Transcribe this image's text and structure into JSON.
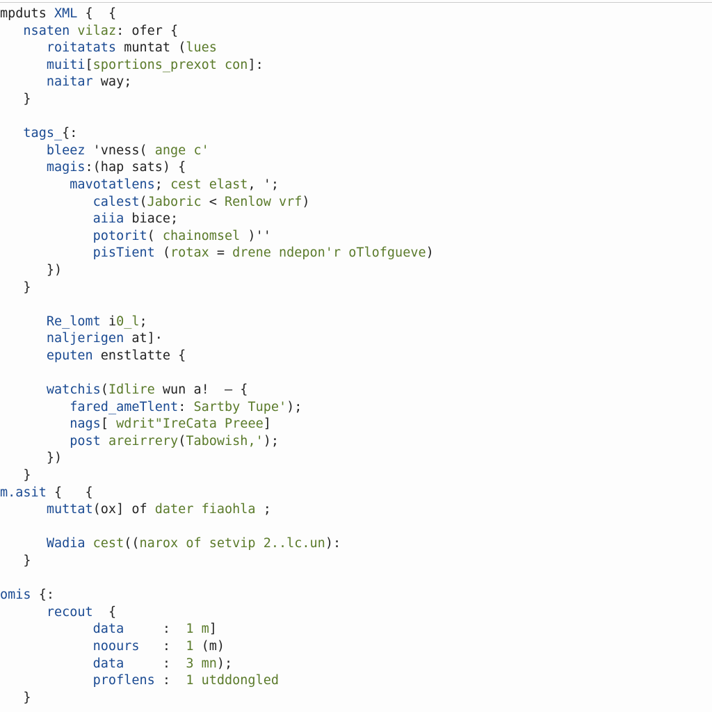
{
  "code": {
    "lines": [
      {
        "indent": 0,
        "spans": [
          {
            "t": "mpduts ",
            "c": "pl"
          },
          {
            "t": "XML ",
            "c": "kw"
          },
          {
            "t": "{  {",
            "c": "pl"
          }
        ]
      },
      {
        "indent": 1,
        "spans": [
          {
            "t": "nsaten ",
            "c": "kw"
          },
          {
            "t": "vilaz",
            "c": "fn"
          },
          {
            "t": ": ofer {",
            "c": "pl"
          }
        ]
      },
      {
        "indent": 2,
        "spans": [
          {
            "t": "roitatats ",
            "c": "kw"
          },
          {
            "t": "muntat ",
            "c": "pl"
          },
          {
            "t": "(",
            "c": "pl"
          },
          {
            "t": "lues",
            "c": "fn"
          }
        ]
      },
      {
        "indent": 2,
        "spans": [
          {
            "t": "muiti",
            "c": "kw"
          },
          {
            "t": "[",
            "c": "pl"
          },
          {
            "t": "sportions_prexot con",
            "c": "fn"
          },
          {
            "t": "]:",
            "c": "pl"
          }
        ]
      },
      {
        "indent": 2,
        "spans": [
          {
            "t": "naitar ",
            "c": "kw"
          },
          {
            "t": "way;",
            "c": "pl"
          }
        ]
      },
      {
        "indent": 1,
        "spans": [
          {
            "t": "}",
            "c": "pl"
          }
        ]
      },
      {
        "indent": 0,
        "spans": [
          {
            "t": "",
            "c": "pl"
          }
        ]
      },
      {
        "indent": 1,
        "spans": [
          {
            "t": "tags_",
            "c": "kw"
          },
          {
            "t": "{:",
            "c": "pl"
          }
        ]
      },
      {
        "indent": 2,
        "spans": [
          {
            "t": "bleez ",
            "c": "kw"
          },
          {
            "t": "'vness( ",
            "c": "pl"
          },
          {
            "t": "ange c'",
            "c": "fn"
          }
        ]
      },
      {
        "indent": 2,
        "spans": [
          {
            "t": "magis",
            "c": "kw"
          },
          {
            "t": ":(hap sats) {",
            "c": "pl"
          }
        ]
      },
      {
        "indent": 3,
        "spans": [
          {
            "t": "mavotatlens",
            "c": "kw"
          },
          {
            "t": "; ",
            "c": "pl"
          },
          {
            "t": "cest elast",
            "c": "fn"
          },
          {
            "t": ", ';",
            "c": "pl"
          }
        ]
      },
      {
        "indent": 4,
        "spans": [
          {
            "t": "calest",
            "c": "kw"
          },
          {
            "t": "(",
            "c": "pl"
          },
          {
            "t": "Jaboric ",
            "c": "fn"
          },
          {
            "t": "< ",
            "c": "pl"
          },
          {
            "t": "Renlow vrf",
            "c": "fn"
          },
          {
            "t": ")",
            "c": "pl"
          }
        ]
      },
      {
        "indent": 4,
        "spans": [
          {
            "t": "aiia ",
            "c": "kw"
          },
          {
            "t": "biace;",
            "c": "pl"
          }
        ]
      },
      {
        "indent": 4,
        "spans": [
          {
            "t": "potorit",
            "c": "kw"
          },
          {
            "t": "( ",
            "c": "pl"
          },
          {
            "t": "chainomsel",
            "c": "fn"
          },
          {
            "t": " )''",
            "c": "pl"
          }
        ]
      },
      {
        "indent": 4,
        "spans": [
          {
            "t": "pisTient ",
            "c": "kw"
          },
          {
            "t": "(",
            "c": "pl"
          },
          {
            "t": "rotax ",
            "c": "fn"
          },
          {
            "t": "= ",
            "c": "pl"
          },
          {
            "t": "drene ndepon'r oTlofgueve",
            "c": "fn"
          },
          {
            "t": ")",
            "c": "pl"
          }
        ]
      },
      {
        "indent": 2,
        "spans": [
          {
            "t": "})",
            "c": "pl"
          }
        ]
      },
      {
        "indent": 1,
        "spans": [
          {
            "t": "}",
            "c": "pl"
          }
        ]
      },
      {
        "indent": 0,
        "spans": [
          {
            "t": "",
            "c": "pl"
          }
        ]
      },
      {
        "indent": 2,
        "spans": [
          {
            "t": "Re_lomt ",
            "c": "kw"
          },
          {
            "t": "i",
            "c": "pl"
          },
          {
            "t": "0_l",
            "c": "fn"
          },
          {
            "t": ";",
            "c": "pl"
          }
        ]
      },
      {
        "indent": 2,
        "spans": [
          {
            "t": "naljerigen ",
            "c": "kw"
          },
          {
            "t": "at]·",
            "c": "pl"
          }
        ]
      },
      {
        "indent": 2,
        "spans": [
          {
            "t": "eputen ",
            "c": "kw"
          },
          {
            "t": "enstlatte {",
            "c": "pl"
          }
        ]
      },
      {
        "indent": 0,
        "spans": [
          {
            "t": "",
            "c": "pl"
          }
        ]
      },
      {
        "indent": 2,
        "spans": [
          {
            "t": "watchis",
            "c": "kw"
          },
          {
            "t": "(",
            "c": "pl"
          },
          {
            "t": "Idlire ",
            "c": "fn"
          },
          {
            "t": "wun a!  — {",
            "c": "pl"
          }
        ]
      },
      {
        "indent": 3,
        "spans": [
          {
            "t": "fared_ameTlent",
            "c": "kw"
          },
          {
            "t": ": ",
            "c": "pl"
          },
          {
            "t": "Sartby Tupe'",
            "c": "fn"
          },
          {
            "t": ");",
            "c": "pl"
          }
        ]
      },
      {
        "indent": 3,
        "spans": [
          {
            "t": "nags",
            "c": "kw"
          },
          {
            "t": "[ ",
            "c": "pl"
          },
          {
            "t": "wdrit\"IreCata Preee",
            "c": "fn"
          },
          {
            "t": "]",
            "c": "pl"
          }
        ]
      },
      {
        "indent": 3,
        "spans": [
          {
            "t": "post ",
            "c": "kw"
          },
          {
            "t": "areirrery",
            "c": "fn"
          },
          {
            "t": "(",
            "c": "pl"
          },
          {
            "t": "Tabowish,'",
            "c": "fn"
          },
          {
            "t": ");",
            "c": "pl"
          }
        ]
      },
      {
        "indent": 2,
        "spans": [
          {
            "t": "})",
            "c": "pl"
          }
        ]
      },
      {
        "indent": 1,
        "spans": [
          {
            "t": "}",
            "c": "pl"
          }
        ]
      },
      {
        "indent": 0,
        "spans": [
          {
            "t": "m.asit ",
            "c": "kw"
          },
          {
            "t": "{   {",
            "c": "pl"
          }
        ]
      },
      {
        "indent": 2,
        "spans": [
          {
            "t": "muttat",
            "c": "kw"
          },
          {
            "t": "(ox] of ",
            "c": "pl"
          },
          {
            "t": "dater fiaohla",
            "c": "fn"
          },
          {
            "t": " ;",
            "c": "pl"
          }
        ]
      },
      {
        "indent": 0,
        "spans": [
          {
            "t": "",
            "c": "pl"
          }
        ]
      },
      {
        "indent": 2,
        "spans": [
          {
            "t": "Wadia ",
            "c": "kw"
          },
          {
            "t": "cest",
            "c": "fn"
          },
          {
            "t": "((",
            "c": "pl"
          },
          {
            "t": "narox of setvip 2..lc.un",
            "c": "fn"
          },
          {
            "t": "):",
            "c": "pl"
          }
        ]
      },
      {
        "indent": 1,
        "spans": [
          {
            "t": "}",
            "c": "pl"
          }
        ]
      },
      {
        "indent": 0,
        "spans": [
          {
            "t": "",
            "c": "pl"
          }
        ]
      },
      {
        "indent": 0,
        "spans": [
          {
            "t": "omis ",
            "c": "kw"
          },
          {
            "t": "{:",
            "c": "pl"
          }
        ]
      },
      {
        "indent": 2,
        "spans": [
          {
            "t": "recout  ",
            "c": "kw"
          },
          {
            "t": "{",
            "c": "pl"
          }
        ]
      },
      {
        "indent": 4,
        "spans": [
          {
            "t": "data     ",
            "c": "kw"
          },
          {
            "t": ":  ",
            "c": "pl"
          },
          {
            "t": "1 m",
            "c": "fn"
          },
          {
            "t": "]",
            "c": "pl"
          }
        ]
      },
      {
        "indent": 4,
        "spans": [
          {
            "t": "noours   ",
            "c": "kw"
          },
          {
            "t": ":  ",
            "c": "pl"
          },
          {
            "t": "1 ",
            "c": "fn"
          },
          {
            "t": "(m)",
            "c": "pl"
          }
        ]
      },
      {
        "indent": 4,
        "spans": [
          {
            "t": "data     ",
            "c": "kw"
          },
          {
            "t": ":  ",
            "c": "pl"
          },
          {
            "t": "3 mn",
            "c": "fn"
          },
          {
            "t": ");",
            "c": "pl"
          }
        ]
      },
      {
        "indent": 4,
        "spans": [
          {
            "t": "proflens ",
            "c": "kw"
          },
          {
            "t": ":  ",
            "c": "pl"
          },
          {
            "t": "1 utddongled",
            "c": "fn"
          }
        ]
      },
      {
        "indent": 1,
        "spans": [
          {
            "t": "}",
            "c": "pl"
          }
        ]
      }
    ],
    "indent_unit": "   "
  }
}
